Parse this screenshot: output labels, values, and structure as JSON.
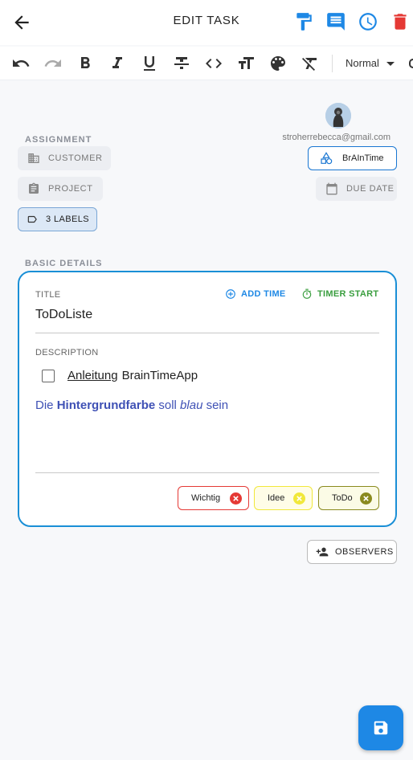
{
  "header": {
    "title": "EDIT TASK",
    "icons": [
      "back-arrow-icon",
      "format-paint-icon",
      "comment-icon",
      "clock-icon",
      "delete-icon"
    ],
    "accent": "#1e88e5",
    "danger": "#e53935"
  },
  "toolbar": {
    "buttons": [
      "undo",
      "redo",
      "bold",
      "italic",
      "underline",
      "strikethrough",
      "code",
      "text-size",
      "palette",
      "clear-format"
    ],
    "format_select": "Normal"
  },
  "assignment": {
    "label": "ASSIGNMENT",
    "customer": "CUSTOMER",
    "project": "PROJECT",
    "labels": "3 LABELS",
    "email": "stroherrebecca@gmail.com",
    "team": "BrAInTime",
    "due_date": "DUE DATE"
  },
  "basic": {
    "label": "BASIC DETAILS",
    "title_label": "TITLE",
    "title_value": "ToDoListe",
    "add_time": "ADD TIME",
    "timer_start": "TIMER START",
    "description_label": "DESCRIPTION",
    "checklist": {
      "checked": false,
      "link_text": "Anleitung",
      "rest_text": "BrainTimeApp"
    },
    "desc": {
      "part1": "Die ",
      "bold": "Hintergrundfarbe",
      "part2": " soll ",
      "italic": "blau",
      "part3": " sein"
    },
    "tags": [
      {
        "label": "Wichtig",
        "color": "#e53935"
      },
      {
        "label": "Idee",
        "color": "#f1e83a"
      },
      {
        "label": "ToDo",
        "color": "#8a8a1e"
      }
    ]
  },
  "observers": "OBSERVERS",
  "save_icon": "save-icon"
}
